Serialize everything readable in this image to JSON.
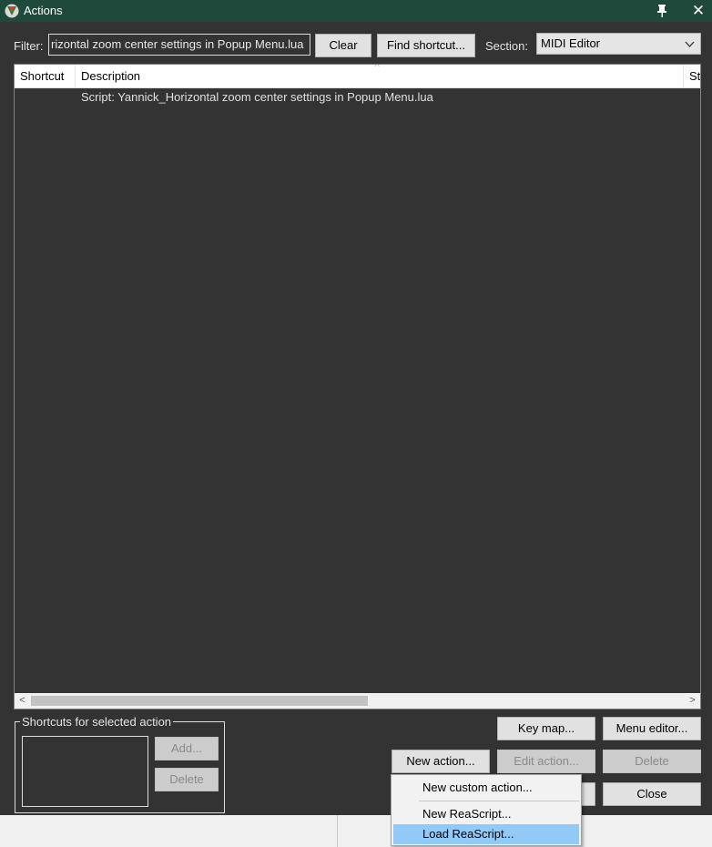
{
  "window": {
    "title": "Actions",
    "pin_glyph": "📌",
    "close_glyph": "✕"
  },
  "filter": {
    "label": "Filter:",
    "value": "rizontal zoom center settings in Popup Menu.lua",
    "clear_label": "Clear",
    "find_shortcut_label": "Find shortcut..."
  },
  "section": {
    "label": "Section:",
    "selected": "MIDI Editor",
    "chevron": "⌵"
  },
  "list": {
    "columns": [
      "Shortcut",
      "Description",
      "St"
    ],
    "sort_indicator": "^",
    "rows": [
      {
        "shortcut": "",
        "description": "Script: Yannick_Horizontal zoom center settings in Popup Menu.lua"
      }
    ],
    "scroll_left": "<",
    "scroll_right": ">"
  },
  "shortcuts_group": {
    "title": "Shortcuts for selected action",
    "add_label": "Add...",
    "delete_label": "Delete"
  },
  "buttons": {
    "key_map": "Key map...",
    "menu_editor": "Menu editor...",
    "new_action": "New action...",
    "edit_action": "Edit action...",
    "delete": "Delete",
    "close": "Close"
  },
  "context_menu": {
    "items": [
      "New custom action...",
      "New ReaScript...",
      "Load ReaScript..."
    ],
    "highlighted": "Load ReaScript..."
  },
  "colors": {
    "titlebar": "#1f4a3b",
    "client_bg": "#333333",
    "menu_highlight": "#91c9f7"
  }
}
